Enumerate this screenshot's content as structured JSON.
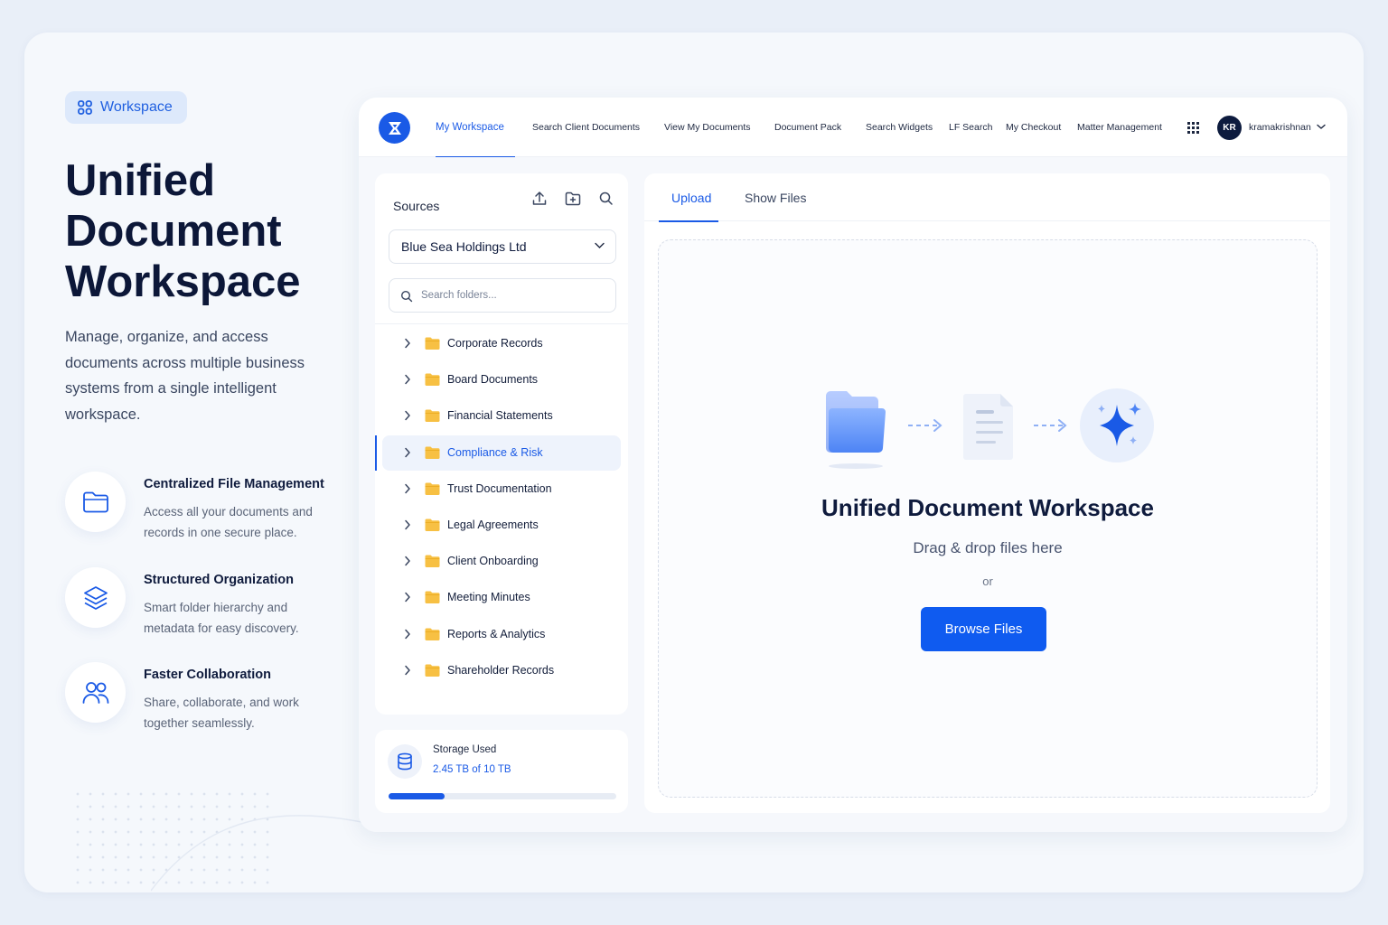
{
  "badge": {
    "label": "Workspace"
  },
  "hero": {
    "title_lines": [
      "Unified",
      "Document",
      "Workspace"
    ],
    "description": "Manage, organize, and access documents across multiple business systems from a single intelligent workspace."
  },
  "features": [
    {
      "title": "Centralized File Management",
      "description": "Access all your documents and records in one secure place.",
      "icon": "folder-icon"
    },
    {
      "title": "Structured Organization",
      "description": "Smart folder hierarchy and metadata for easy discovery.",
      "icon": "layers-icon"
    },
    {
      "title": "Faster Collaboration",
      "description": "Share, collaborate, and work together seamlessly.",
      "icon": "users-icon"
    }
  ],
  "nav": {
    "items": [
      {
        "label": "My Workspace",
        "active": true
      },
      {
        "label": "Search Client Documents"
      },
      {
        "label": "View My Documents"
      },
      {
        "label": "Document Pack"
      },
      {
        "label": "Search Widgets"
      },
      {
        "label": "LF Search"
      },
      {
        "label": "My Checkout"
      },
      {
        "label": "Matter Management"
      }
    ],
    "user": {
      "initials": "KR",
      "name": "kramakrishnan"
    }
  },
  "sources": {
    "title": "Sources",
    "selected_entity": "Blue Sea Holdings Ltd",
    "search_placeholder": "Search folders...",
    "folders": [
      "Corporate Records",
      "Board Documents",
      "Financial Statements",
      "Compliance & Risk",
      "Trust Documentation",
      "Legal Agreements",
      "Client Onboarding",
      "Meeting Minutes",
      "Reports & Analytics",
      "Shareholder Records"
    ],
    "active_folder": "Compliance & Risk"
  },
  "storage": {
    "label": "Storage Used",
    "used": "2.45 TB",
    "of": "of",
    "total": "10 TB",
    "fraction": 0.245
  },
  "upload": {
    "tabs": [
      "Upload",
      "Show Files"
    ],
    "active_tab": "Upload",
    "title": "Unified Document Workspace",
    "subtitle": "Drag & drop files here",
    "or": "or",
    "browse_label": "Browse Files"
  },
  "colors": {
    "accent": "#1a5ae6",
    "folder": "#f5b82e",
    "dark": "#0c1738"
  }
}
